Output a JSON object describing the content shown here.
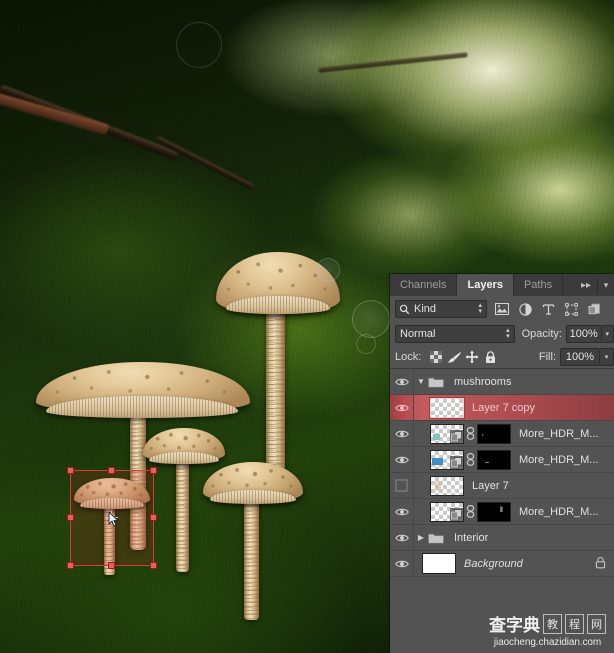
{
  "app": "Adobe Photoshop — Layers panel over mushroom photograph",
  "panel": {
    "tabs": [
      {
        "label": "Channels",
        "active": false
      },
      {
        "label": "Layers",
        "active": true
      },
      {
        "label": "Paths",
        "active": false
      }
    ],
    "collapse_icon": "double-chevron-right-icon",
    "menu_icon": "panel-menu-icon",
    "filter": {
      "search_icon": "search-icon",
      "kind_value": "Kind",
      "stepper_icon": "up-down-stepper-icon",
      "icons": [
        {
          "name": "filter-pixel-icon",
          "glyph": "image"
        },
        {
          "name": "filter-adjustment-icon",
          "glyph": "half-circle"
        },
        {
          "name": "filter-type-icon",
          "glyph": "T"
        },
        {
          "name": "filter-shape-icon",
          "glyph": "shape"
        },
        {
          "name": "filter-smart-object-icon",
          "glyph": "smart"
        }
      ]
    },
    "blend": {
      "mode_value": "Normal",
      "opacity_label": "Opacity:",
      "opacity_value": "100%"
    },
    "lock": {
      "label": "Lock:",
      "icons": [
        {
          "name": "lock-transparent-pixels-icon"
        },
        {
          "name": "lock-image-pixels-icon"
        },
        {
          "name": "lock-position-icon"
        },
        {
          "name": "lock-all-icon"
        }
      ],
      "fill_label": "Fill:",
      "fill_value": "100%"
    },
    "layers": [
      {
        "name": "mushrooms",
        "type": "group",
        "visible": true,
        "expanded": true,
        "selected": false,
        "indent": 0,
        "thumb": "none",
        "locked": false
      },
      {
        "name": "Layer 7 copy",
        "type": "layer",
        "visible": true,
        "selected": true,
        "indent": 1,
        "thumb": "transparent",
        "mask": false,
        "smart": false,
        "locked": false
      },
      {
        "name": "More_HDR_M...",
        "type": "layer",
        "visible": true,
        "selected": false,
        "indent": 1,
        "thumb": "transparent",
        "mask": true,
        "smart": true,
        "locked": false
      },
      {
        "name": "More_HDR_M...",
        "type": "layer",
        "visible": true,
        "selected": false,
        "indent": 1,
        "thumb": "transparent",
        "mask": true,
        "smart": true,
        "locked": false
      },
      {
        "name": "Layer 7",
        "type": "layer",
        "visible": false,
        "selected": false,
        "indent": 1,
        "thumb": "transparent",
        "mask": false,
        "smart": false,
        "locked": false
      },
      {
        "name": "More_HDR_M...",
        "type": "layer",
        "visible": true,
        "selected": false,
        "indent": 1,
        "thumb": "transparent",
        "mask": true,
        "smart": true,
        "locked": false
      },
      {
        "name": "Interior",
        "type": "group",
        "visible": true,
        "expanded": false,
        "selected": false,
        "indent": 0,
        "thumb": "none",
        "locked": false
      },
      {
        "name": "Background",
        "type": "layer",
        "visible": true,
        "selected": false,
        "indent": 0,
        "thumb": "white",
        "mask": false,
        "smart": false,
        "italic": true,
        "locked": true
      }
    ]
  },
  "canvas": {
    "description": "Photograph of parasol mushrooms growing on sunlit green moss",
    "transform_selection": {
      "name": "free-transform-bounding-box",
      "color": "#d13c3c",
      "handles": 8,
      "reference_point": "center"
    }
  },
  "watermark": {
    "cn_text": "查字典",
    "badge_1": "教",
    "badge_2": "程",
    "badge_3": "网",
    "url": "jiaocheng.chazidian.com"
  }
}
